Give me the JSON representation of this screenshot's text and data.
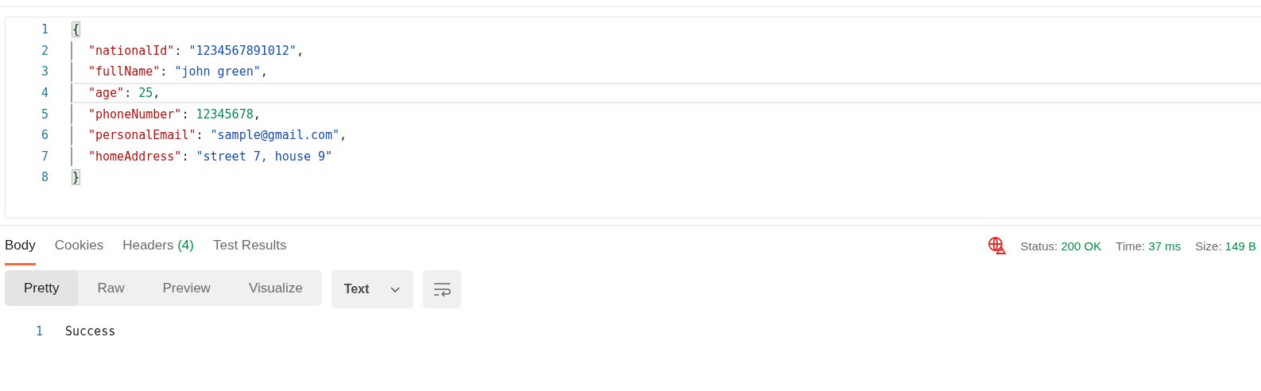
{
  "editor": {
    "lines": [
      {
        "number": "1",
        "active": false,
        "indented": false,
        "tokens": [
          {
            "kind": "bracket",
            "text": "{"
          }
        ]
      },
      {
        "number": "2",
        "active": false,
        "indented": true,
        "tokens": [
          {
            "kind": "key",
            "text": "\"nationalId\""
          },
          {
            "kind": "punct",
            "text": ": "
          },
          {
            "kind": "string",
            "text": "\"1234567891012\""
          },
          {
            "kind": "punct",
            "text": ","
          }
        ]
      },
      {
        "number": "3",
        "active": false,
        "indented": true,
        "tokens": [
          {
            "kind": "key",
            "text": "\"fullName\""
          },
          {
            "kind": "punct",
            "text": ": "
          },
          {
            "kind": "string",
            "text": "\"john green\""
          },
          {
            "kind": "punct",
            "text": ","
          }
        ]
      },
      {
        "number": "4",
        "active": true,
        "indented": true,
        "tokens": [
          {
            "kind": "key",
            "text": "\"age\""
          },
          {
            "kind": "punct",
            "text": ": "
          },
          {
            "kind": "number",
            "text": "25"
          },
          {
            "kind": "punct",
            "text": ","
          }
        ]
      },
      {
        "number": "5",
        "active": false,
        "indented": true,
        "tokens": [
          {
            "kind": "key",
            "text": "\"phoneNumber\""
          },
          {
            "kind": "punct",
            "text": ": "
          },
          {
            "kind": "number",
            "text": "12345678"
          },
          {
            "kind": "punct",
            "text": ","
          }
        ]
      },
      {
        "number": "6",
        "active": false,
        "indented": true,
        "tokens": [
          {
            "kind": "key",
            "text": "\"personalEmail\""
          },
          {
            "kind": "punct",
            "text": ": "
          },
          {
            "kind": "string",
            "text": "\"sample@gmail.com\""
          },
          {
            "kind": "punct",
            "text": ","
          }
        ]
      },
      {
        "number": "7",
        "active": false,
        "indented": true,
        "tokens": [
          {
            "kind": "key",
            "text": "\"homeAddress\""
          },
          {
            "kind": "punct",
            "text": ": "
          },
          {
            "kind": "string",
            "text": "\"street 7, house 9\""
          }
        ]
      },
      {
        "number": "8",
        "active": false,
        "indented": false,
        "tokens": [
          {
            "kind": "bracket",
            "text": "}"
          }
        ]
      }
    ]
  },
  "response_tabs": [
    {
      "label": "Body",
      "selected": true
    },
    {
      "label": "Cookies",
      "selected": false
    },
    {
      "label": "Headers",
      "count": "(4)",
      "selected": false
    },
    {
      "label": "Test Results",
      "selected": false
    }
  ],
  "status": [
    {
      "label": "Status:",
      "value": "200 OK"
    },
    {
      "label": "Time:",
      "value": "37 ms"
    },
    {
      "label": "Size:",
      "value": "149 B"
    }
  ],
  "view_modes": [
    {
      "label": "Pretty",
      "selected": true
    },
    {
      "label": "Raw",
      "selected": false
    },
    {
      "label": "Preview",
      "selected": false
    },
    {
      "label": "Visualize",
      "selected": false
    }
  ],
  "format_select": {
    "value": "Text"
  },
  "response_body": {
    "lines": [
      {
        "number": "1",
        "text": "Success"
      }
    ]
  }
}
